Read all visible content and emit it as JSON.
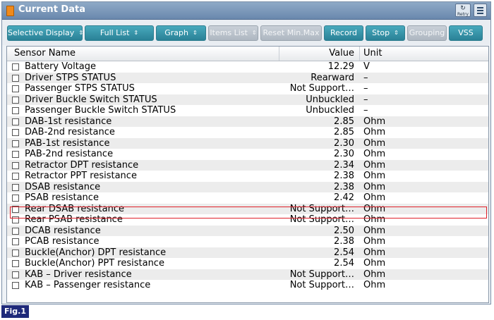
{
  "window": {
    "title": "Current Data",
    "retry_label": "Retry"
  },
  "toolbar": {
    "buttons": [
      {
        "label": "Selective Display",
        "dropdown": true,
        "enabled": true
      },
      {
        "label": "Full List",
        "dropdown": true,
        "enabled": true
      },
      {
        "label": "Graph",
        "dropdown": true,
        "enabled": true
      },
      {
        "label": "Items List",
        "dropdown": true,
        "enabled": false
      },
      {
        "label": "Reset Min.Max",
        "dropdown": false,
        "enabled": false
      },
      {
        "label": "Record",
        "dropdown": false,
        "enabled": true
      },
      {
        "label": "Stop",
        "dropdown": true,
        "enabled": true
      },
      {
        "label": "Grouping",
        "dropdown": false,
        "enabled": false
      },
      {
        "label": "VSS",
        "dropdown": false,
        "enabled": true
      }
    ]
  },
  "table": {
    "headers": {
      "name": "Sensor Name",
      "value": "Value",
      "unit": "Unit"
    },
    "rows": [
      {
        "name": "Battery Voltage",
        "value": "12.29",
        "unit": "V"
      },
      {
        "name": "Driver STPS STATUS",
        "value": "Rearward",
        "unit": "–"
      },
      {
        "name": "Passenger STPS STATUS",
        "value": "Not Support…",
        "unit": "–"
      },
      {
        "name": "Driver Buckle Switch STATUS",
        "value": "Unbuckled",
        "unit": "–"
      },
      {
        "name": "Passenger Buckle Switch STATUS",
        "value": "Unbuckled",
        "unit": "–"
      },
      {
        "name": "DAB-1st resistance",
        "value": "2.85",
        "unit": "Ohm"
      },
      {
        "name": "DAB-2nd resistance",
        "value": "2.85",
        "unit": "Ohm"
      },
      {
        "name": "PAB-1st resistance",
        "value": "2.30",
        "unit": "Ohm"
      },
      {
        "name": "PAB-2nd resistance",
        "value": "2.30",
        "unit": "Ohm"
      },
      {
        "name": "Retractor DPT resistance",
        "value": "2.34",
        "unit": "Ohm"
      },
      {
        "name": "Retractor PPT resistance",
        "value": "2.38",
        "unit": "Ohm"
      },
      {
        "name": "DSAB resistance",
        "value": "2.38",
        "unit": "Ohm"
      },
      {
        "name": "PSAB resistance",
        "value": "2.42",
        "unit": "Ohm",
        "highlighted": true
      },
      {
        "name": "Rear DSAB resistance",
        "value": "Not Support…",
        "unit": "Ohm"
      },
      {
        "name": "Rear PSAB resistance",
        "value": "Not Support…",
        "unit": "Ohm"
      },
      {
        "name": "DCAB resistance",
        "value": "2.50",
        "unit": "Ohm"
      },
      {
        "name": "PCAB resistance",
        "value": "2.38",
        "unit": "Ohm"
      },
      {
        "name": "Buckle(Anchor) DPT resistance",
        "value": "2.54",
        "unit": "Ohm"
      },
      {
        "name": "Buckle(Anchor) PPT resistance",
        "value": "2.54",
        "unit": "Ohm"
      },
      {
        "name": "KAB – Driver resistance",
        "value": "Not Support…",
        "unit": "Ohm"
      },
      {
        "name": "KAB – Passenger resistance",
        "value": "Not Support…",
        "unit": "Ohm"
      }
    ]
  },
  "figure_label": "Fig.1",
  "colors": {
    "accent_button": "#2a8196",
    "highlight_border": "#e0202a",
    "title_bar": "#7a96b8"
  }
}
